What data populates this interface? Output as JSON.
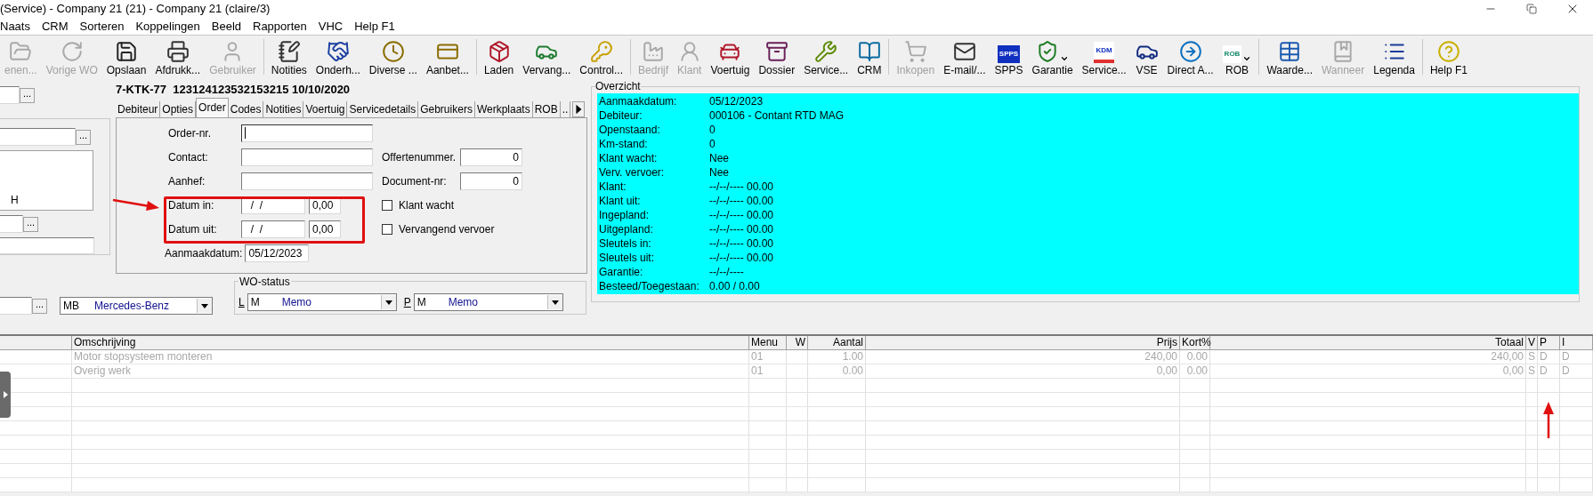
{
  "window": {
    "title": "(Service) - Company 21 (21) - Company 21 (claire/3)"
  },
  "menu": [
    "Naats",
    "CRM",
    "Sorteren",
    "Koppelingen",
    "Beeld",
    "Rapporten",
    "VHC",
    "Help F1"
  ],
  "toolbar": {
    "groups": [
      [
        {
          "label": "enen...",
          "disabled": true
        },
        {
          "label": "Vorige WO",
          "disabled": true
        },
        {
          "label": "Opslaan",
          "disabled": false
        },
        {
          "label": "Afdrukk...",
          "disabled": false
        },
        {
          "label": "Gebruiker",
          "disabled": true
        }
      ],
      [
        {
          "label": "Notities",
          "disabled": false
        },
        {
          "label": "Onderh...",
          "disabled": false
        },
        {
          "label": "Diverse ...",
          "disabled": false
        },
        {
          "label": "Aanbet...",
          "disabled": false
        }
      ],
      [
        {
          "label": "Laden",
          "disabled": false
        },
        {
          "label": "Vervang...",
          "disabled": false
        },
        {
          "label": "Control...",
          "disabled": false
        }
      ],
      [
        {
          "label": "Bedrijf",
          "disabled": true
        },
        {
          "label": "Klant",
          "disabled": true
        },
        {
          "label": "Voertuig",
          "disabled": false
        },
        {
          "label": "Dossier",
          "disabled": false
        },
        {
          "label": "Service...",
          "disabled": false
        },
        {
          "label": "CRM",
          "disabled": false
        }
      ],
      [
        {
          "label": "Inkopen",
          "disabled": true
        },
        {
          "label": "E-mail/...",
          "disabled": false
        },
        {
          "label": "SPPS",
          "disabled": false,
          "badge": "SPPS"
        },
        {
          "label": "Garantie",
          "disabled": false,
          "dropdown": true
        },
        {
          "label": "Service...",
          "disabled": false,
          "badge": "KDM"
        },
        {
          "label": "VSE",
          "disabled": false
        },
        {
          "label": "Direct A...",
          "disabled": false
        },
        {
          "label": "ROB",
          "disabled": false,
          "badge": "ROB",
          "dropdown": true
        }
      ],
      [
        {
          "label": "Waarde...",
          "disabled": false
        },
        {
          "label": "Wanneer",
          "disabled": true
        },
        {
          "label": "Legenda",
          "disabled": false
        }
      ],
      [
        {
          "label": "Help F1",
          "disabled": false
        }
      ]
    ]
  },
  "left_panel": {
    "top_button": "...",
    "group_button": "...",
    "list_text": "H",
    "lower_button": "..."
  },
  "record_header": "7-KTK-77  123124123532153215 10/10/2020",
  "tabs": [
    {
      "label": "Debiteur",
      "selected": false
    },
    {
      "label": "Opties",
      "selected": false
    },
    {
      "label": "Order",
      "selected": true
    },
    {
      "label": "Codes",
      "selected": false
    },
    {
      "label": "Notities",
      "selected": false
    },
    {
      "label": "Voertuig",
      "selected": false
    },
    {
      "label": "Servicedetails",
      "selected": false
    },
    {
      "label": "Gebruikers",
      "selected": false
    },
    {
      "label": "Werkplaats",
      "selected": false
    },
    {
      "label": "ROB",
      "selected": false
    },
    {
      "label": "..",
      "selected": false
    }
  ],
  "order_form": {
    "fields": [
      {
        "label": "Order-nr.",
        "focused": true
      },
      {
        "label": "Contact:",
        "focused": false
      },
      {
        "label": "Aanhef:",
        "focused": false
      }
    ],
    "dates": [
      {
        "label": "Datum in:",
        "date": "  /  /",
        "time": "0,00"
      },
      {
        "label": "Datum uit:",
        "date": "  /  /",
        "time": "0,00"
      }
    ],
    "created": {
      "label": "Aanmaakdatum:",
      "value": "05/12/2023"
    },
    "numbers": [
      {
        "label": "Offertenummer.",
        "value": "0"
      },
      {
        "label": "Document-nr:",
        "value": "0"
      }
    ],
    "checkboxes": [
      {
        "label": "Klant wacht",
        "checked": false
      },
      {
        "label": "Vervangend vervoer",
        "checked": false
      }
    ]
  },
  "overview": {
    "title": "Overzicht",
    "rows": [
      {
        "label": "Aanmaakdatum:",
        "value": "05/12/2023"
      },
      {
        "label": "Debiteur:",
        "value": "000106 - Contant RTD MAG"
      },
      {
        "label": "Openstaand:",
        "value": "0"
      },
      {
        "label": "Km-stand:",
        "value": "0"
      },
      {
        "label": "Klant wacht:",
        "value": "Nee"
      },
      {
        "label": "Verv. vervoer:",
        "value": "Nee"
      },
      {
        "label": "Klant:",
        "value": "--/--/---- 00.00"
      },
      {
        "label": "Klant uit:",
        "value": "--/--/---- 00.00"
      },
      {
        "label": "Ingepland:",
        "value": "--/--/---- 00.00"
      },
      {
        "label": "Uitgepland:",
        "value": "--/--/---- 00.00"
      },
      {
        "label": "Sleutels in:",
        "value": "--/--/---- 00.00"
      },
      {
        "label": "Sleutels uit:",
        "value": "--/--/---- 00.00"
      },
      {
        "label": "Garantie:",
        "value": "--/--/----"
      },
      {
        "label": "Besteed/Toegestaan:",
        "value": "0.00 / 0.00"
      }
    ]
  },
  "bottom_row": {
    "browse_button": "...",
    "make": {
      "code": "MB",
      "name": "Mercedes-Benz"
    }
  },
  "wo_status": {
    "title": "WO-status",
    "combos": [
      {
        "prefix": "L",
        "code": "M",
        "value": "Memo"
      },
      {
        "prefix": "P",
        "code": "M",
        "value": "Memo"
      }
    ]
  },
  "table": {
    "columns": [
      "Omschrijving",
      "Menu",
      "W",
      "Aantal",
      "Prijs",
      "Kort%",
      "Totaal",
      "V",
      "P",
      "I"
    ],
    "rows": [
      [
        "Motor stopsysteem monteren",
        "01",
        "",
        "1.00",
        "240,00",
        "0.00",
        "240,00",
        "S",
        "D",
        "D"
      ],
      [
        "Overig werk",
        "01",
        "",
        "0.00",
        "0,00",
        "0.00",
        "0,00",
        "S",
        "D",
        "D"
      ]
    ]
  }
}
